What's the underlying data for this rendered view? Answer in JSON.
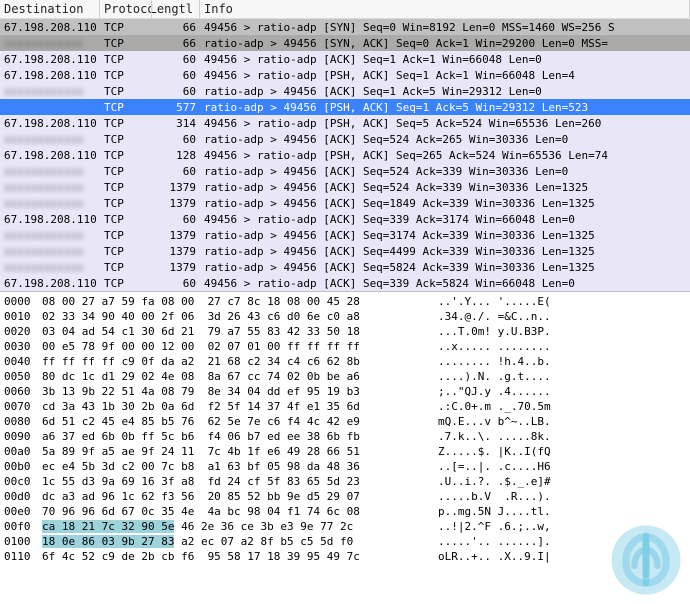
{
  "columns": {
    "destination": "Destination",
    "protocol": "Protoco",
    "length": "Lengtl",
    "info": "Info"
  },
  "packets": [
    {
      "dest": "67.198.208.110",
      "blur": false,
      "proto": "TCP",
      "len": "66",
      "info": "49456 > ratio-adp [SYN] Seq=0 Win=8192 Len=0 MSS=1460 WS=256 S",
      "style": "dark1"
    },
    {
      "dest": "xxxxxxxxxxxx",
      "blur": true,
      "proto": "TCP",
      "len": "66",
      "info": "ratio-adp > 49456 [SYN, ACK] Seq=0 Ack=1 Win=29200 Len=0 MSS=",
      "style": "dark2"
    },
    {
      "dest": "67.198.208.110",
      "blur": false,
      "proto": "TCP",
      "len": "60",
      "info": "49456 > ratio-adp [ACK] Seq=1 Ack=1 Win=66048 Len=0",
      "style": "pale"
    },
    {
      "dest": "67.198.208.110",
      "blur": false,
      "proto": "TCP",
      "len": "60",
      "info": "49456 > ratio-adp [PSH, ACK] Seq=1 Ack=1 Win=66048 Len=4",
      "style": "pale"
    },
    {
      "dest": "xxxxxxxxxxxx",
      "blur": true,
      "proto": "TCP",
      "len": "60",
      "info": "ratio-adp > 49456 [ACK] Seq=1 Ack=5 Win=29312 Len=0",
      "style": "pale"
    },
    {
      "dest": "",
      "blur": false,
      "proto": "TCP",
      "len": "577",
      "info": "ratio-adp > 49456 [PSH, ACK] Seq=1 Ack=5 Win=29312 Len=523",
      "style": "sel"
    },
    {
      "dest": "67.198.208.110",
      "blur": false,
      "proto": "TCP",
      "len": "314",
      "info": "49456 > ratio-adp [PSH, ACK] Seq=5 Ack=524 Win=65536 Len=260",
      "style": "pale"
    },
    {
      "dest": "xxxxxxxxxxxx",
      "blur": true,
      "proto": "TCP",
      "len": "60",
      "info": "ratio-adp > 49456 [ACK] Seq=524 Ack=265 Win=30336 Len=0",
      "style": "pale"
    },
    {
      "dest": "67.198.208.110",
      "blur": false,
      "proto": "TCP",
      "len": "128",
      "info": "49456 > ratio-adp [PSH, ACK] Seq=265 Ack=524 Win=65536 Len=74",
      "style": "pale"
    },
    {
      "dest": "xxxxxxxxxxxx",
      "blur": true,
      "proto": "TCP",
      "len": "60",
      "info": "ratio-adp > 49456 [ACK] Seq=524 Ack=339 Win=30336 Len=0",
      "style": "pale"
    },
    {
      "dest": "xxxxxxxxxxxx",
      "blur": true,
      "proto": "TCP",
      "len": "1379",
      "info": "ratio-adp > 49456 [ACK] Seq=524 Ack=339 Win=30336 Len=1325",
      "style": "pale"
    },
    {
      "dest": "xxxxxxxxxxxx",
      "blur": true,
      "proto": "TCP",
      "len": "1379",
      "info": "ratio-adp > 49456 [ACK] Seq=1849 Ack=339 Win=30336 Len=1325",
      "style": "pale"
    },
    {
      "dest": "67.198.208.110",
      "blur": false,
      "proto": "TCP",
      "len": "60",
      "info": "49456 > ratio-adp [ACK] Seq=339 Ack=3174 Win=66048 Len=0",
      "style": "pale"
    },
    {
      "dest": "xxxxxxxxxxxx",
      "blur": true,
      "proto": "TCP",
      "len": "1379",
      "info": "ratio-adp > 49456 [ACK] Seq=3174 Ack=339 Win=30336 Len=1325",
      "style": "pale"
    },
    {
      "dest": "xxxxxxxxxxxx",
      "blur": true,
      "proto": "TCP",
      "len": "1379",
      "info": "ratio-adp > 49456 [ACK] Seq=4499 Ack=339 Win=30336 Len=1325",
      "style": "pale"
    },
    {
      "dest": "xxxxxxxxxxxx",
      "blur": true,
      "proto": "TCP",
      "len": "1379",
      "info": "ratio-adp > 49456 [ACK] Seq=5824 Ack=339 Win=30336 Len=1325",
      "style": "pale"
    },
    {
      "dest": "67.198.208.110",
      "blur": false,
      "proto": "TCP",
      "len": "60",
      "info": "49456 > ratio-adp [ACK] Seq=339 Ack=5824 Win=66048 Len=0",
      "style": "pale"
    }
  ],
  "hex": [
    {
      "off": "0000",
      "bytes": "08 00 27 a7 59 fa 08 00  27 c7 8c 18 08 00 45 28",
      "ascii": "..'.Y... '.....E(",
      "hl": null
    },
    {
      "off": "0010",
      "bytes": "02 33 34 90 40 00 2f 06  3d 26 43 c6 d0 6e c0 a8",
      "ascii": ".34.@./. =&C..n..",
      "hl": null
    },
    {
      "off": "0020",
      "bytes": "03 04 ad 54 c1 30 6d 21  79 a7 55 83 42 33 50 18",
      "ascii": "...T.0m! y.U.B3P.",
      "hl": null
    },
    {
      "off": "0030",
      "bytes": "00 e5 78 9f 00 00 12 00  02 07 01 00 ff ff ff ff",
      "ascii": "..x..... ........",
      "hl": null
    },
    {
      "off": "0040",
      "bytes": "ff ff ff ff c9 0f da a2  21 68 c2 34 c4 c6 62 8b",
      "ascii": "........ !h.4..b.",
      "hl": null
    },
    {
      "off": "0050",
      "bytes": "80 dc 1c d1 29 02 4e 08  8a 67 cc 74 02 0b be a6",
      "ascii": "....).N. .g.t....",
      "hl": null
    },
    {
      "off": "0060",
      "bytes": "3b 13 9b 22 51 4a 08 79  8e 34 04 dd ef 95 19 b3",
      "ascii": ";..\"QJ.y .4......",
      "hl": null
    },
    {
      "off": "0070",
      "bytes": "cd 3a 43 1b 30 2b 0a 6d  f2 5f 14 37 4f e1 35 6d",
      "ascii": ".:C.0+.m ._.70.5m",
      "hl": null
    },
    {
      "off": "0080",
      "bytes": "6d 51 c2 45 e4 85 b5 76  62 5e 7e c6 f4 4c 42 e9",
      "ascii": "mQ.E...v b^~..LB.",
      "hl": null
    },
    {
      "off": "0090",
      "bytes": "a6 37 ed 6b 0b ff 5c b6  f4 06 b7 ed ee 38 6b fb",
      "ascii": ".7.k..\\. .....8k.",
      "hl": null
    },
    {
      "off": "00a0",
      "bytes": "5a 89 9f a5 ae 9f 24 11  7c 4b 1f e6 49 28 66 51",
      "ascii": "Z.....$. |K..I(fQ",
      "hl": null
    },
    {
      "off": "00b0",
      "bytes": "ec e4 5b 3d c2 00 7c b8  a1 63 bf 05 98 da 48 36",
      "ascii": "..[=..|. .c....H6",
      "hl": null
    },
    {
      "off": "00c0",
      "bytes": "1c 55 d3 9a 69 16 3f a8  fd 24 cf 5f 83 65 5d 23",
      "ascii": ".U..i.?. .$._.e]#",
      "hl": null
    },
    {
      "off": "00d0",
      "bytes": "dc a3 ad 96 1c 62 f3 56  20 85 52 bb 9e d5 29 07",
      "ascii": ".....b.V  .R...).",
      "hl": null
    },
    {
      "off": "00e0",
      "bytes": "70 96 96 6d 67 0c 35 4e  4a bc 98 04 f1 74 6c 08",
      "ascii": "p..mg.5N J....tl.",
      "hl": null
    },
    {
      "off": "00f0",
      "bytes": "ca 18 21 7c 32 90 5e 46  2e 36 ce 3b e3 9e 77 2c",
      "ascii": "..!|2.^F .6.;..w,",
      "hl": [
        0,
        7
      ]
    },
    {
      "off": "0100",
      "bytes": "18 0e 86 03 9b 27 83 a2  ec 07 a2 8f b5 c5 5d f0",
      "ascii": ".....'.. ......].",
      "hl": [
        0,
        7
      ]
    },
    {
      "off": "0110",
      "bytes": "6f 4c 52 c9 de 2b cb f6  95 58 17 18 39 95 49 7c",
      "ascii": "oLR..+.. .X..9.I|",
      "hl": null
    }
  ],
  "logo": {
    "name": "malwarebytes-icon",
    "color": "#2dabd8"
  }
}
